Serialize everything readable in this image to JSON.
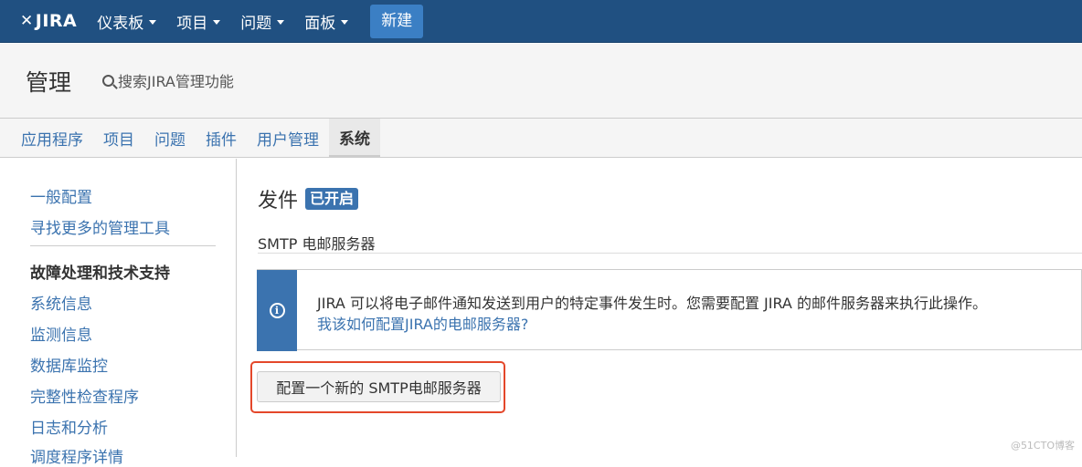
{
  "topbar": {
    "logo": "JIRA",
    "logo_mark": "✕",
    "nav": [
      {
        "label": "仪表板"
      },
      {
        "label": "项目"
      },
      {
        "label": "问题"
      },
      {
        "label": "面板"
      }
    ],
    "create_label": "新建"
  },
  "header": {
    "title": "管理",
    "search_label": "搜索JIRA管理功能"
  },
  "tabs": [
    {
      "label": "应用程序"
    },
    {
      "label": "项目"
    },
    {
      "label": "问题"
    },
    {
      "label": "插件"
    },
    {
      "label": "用户管理"
    },
    {
      "label": "系统",
      "active": true
    }
  ],
  "sidebar": {
    "items_top": [
      "一般配置",
      "寻找更多的管理工具"
    ],
    "section_heading": "故障处理和技术支持",
    "items": [
      "系统信息",
      "监测信息",
      "数据库监控",
      "完整性检查程序",
      "日志和分析",
      "调度程序详情"
    ]
  },
  "main": {
    "title": "发件",
    "status_badge": "已开启",
    "subheading": "SMTP 电邮服务器",
    "info_text": "JIRA 可以将电子邮件通知发送到用户的特定事件发生时。您需要配置 JIRA 的邮件服务器来执行此操作。",
    "info_link": "我该如何配置JIRA的电邮服务器?",
    "add_button": "配置一个新的 SMTP电邮服务器"
  },
  "watermark": "@51CTO博客",
  "colors": {
    "topbar": "#205081",
    "link": "#3b73af",
    "highlight": "#e4472a"
  }
}
